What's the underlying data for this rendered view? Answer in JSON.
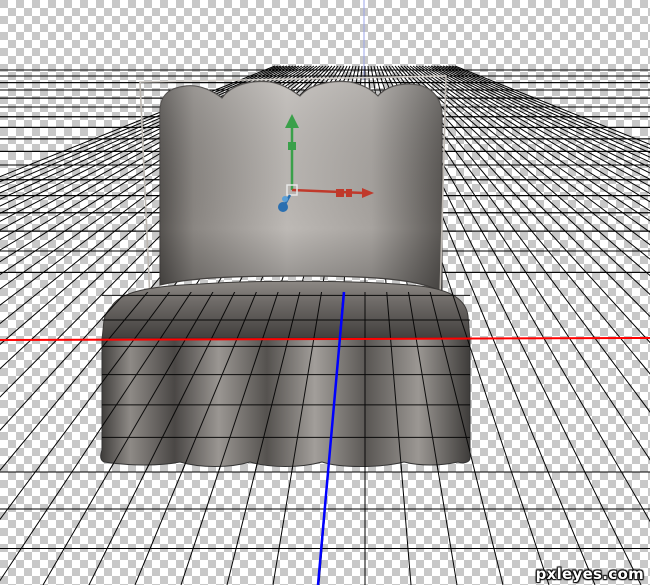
{
  "watermark": {
    "text": "pxleyes.com"
  },
  "colors": {
    "checker_light": "#ffffff",
    "checker_dark": "#c8c8c8",
    "grid_line": "#000000",
    "x_axis": "#ff0000",
    "z_axis": "#0000ff",
    "y_axis_faint": "#9aa3e8",
    "sofa_highlight": "#e6e3df",
    "sofa_mid": "#9a9590",
    "sofa_shadow": "#4c4946",
    "bounding_box": "#bdb8b2",
    "gizmo_y": "#3aa04a",
    "gizmo_x": "#c0392b",
    "gizmo_z": "#2a6fb0"
  },
  "icons": {
    "move_gizmo": "translate-gizmo-icon"
  }
}
